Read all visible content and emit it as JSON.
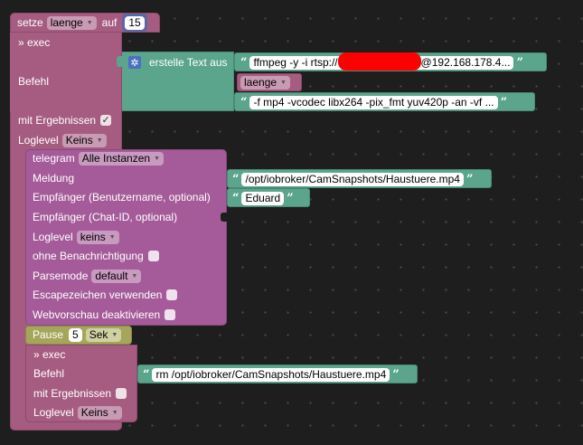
{
  "set_block": {
    "label_set": "setze",
    "variable": "laenge",
    "label_to": "auf",
    "value": "15"
  },
  "exec1": {
    "title": "» exec",
    "command_label": "Befehl",
    "with_results_label": "mit Ergebnissen",
    "with_results_checked": "✓",
    "loglevel_label": "Loglevel",
    "loglevel_value": "Keins"
  },
  "create_text": {
    "label": "erstelle Text aus",
    "gear_icon": "gear-icon",
    "part1": "ffmpeg -y -i rtsp://",
    "part1_tail": "@192.168.178.4...",
    "part2_var": "laenge",
    "part3": "-f mp4 -vcodec libx264 -pix_fmt yuv420p -an -vf ..."
  },
  "telegram": {
    "label": "telegram",
    "instance": "Alle Instanzen",
    "message_label": "Meldung",
    "message_value": "/opt/iobroker/CamSnapshots/Haustuere.mp4",
    "recipient_user_label": "Empfänger (Benutzername, optional)",
    "recipient_user_value": "Eduard",
    "recipient_chat_label": "Empfänger (Chat-ID, optional)",
    "loglevel_label": "Loglevel",
    "loglevel_value": "keins",
    "silent_label": "ohne Benachrichtigung",
    "parsemode_label": "Parsemode",
    "parsemode_value": "default",
    "escape_label": "Escapezeichen verwenden",
    "preview_label": "Webvorschau deaktivieren"
  },
  "pause": {
    "label": "Pause",
    "value": "5",
    "unit": "Sek"
  },
  "exec2": {
    "title": "» exec",
    "command_label": "Befehl",
    "command_value": "rm /opt/iobroker/CamSnapshots/Haustuere.mp4",
    "with_results_label": "mit Ergebnissen",
    "loglevel_label": "Loglevel",
    "loglevel_value": "Keins"
  },
  "colors": {
    "variables": "#a65c81",
    "text": "#5ba58c",
    "telegram": "#a55b99",
    "pause": "#a5a55b",
    "redaction": "#ff0000"
  }
}
